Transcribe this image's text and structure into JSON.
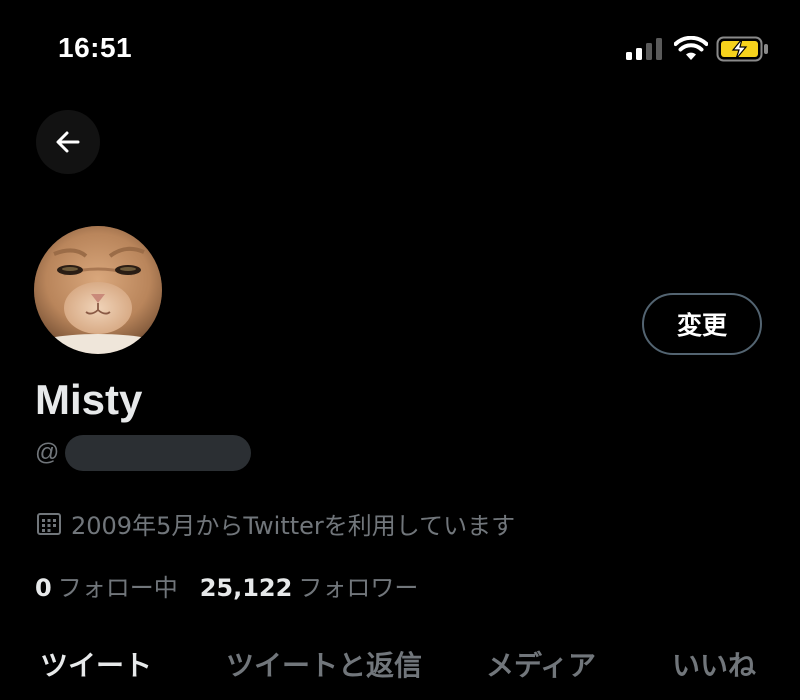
{
  "status_bar": {
    "time": "16:51",
    "icons": [
      "signal-icon",
      "wifi-icon",
      "battery-charging-icon"
    ],
    "battery_color": "#f5d21c"
  },
  "profile": {
    "display_name": "Misty",
    "handle_prefix": "@",
    "edit_label": "変更",
    "joined_text": "2009年5月からTwitterを利用しています",
    "following_count": "0",
    "following_label": "フォロー中",
    "followers_count": "25,122",
    "followers_label": "フォロワー"
  },
  "tabs": [
    {
      "label": "ツイート",
      "active": true
    },
    {
      "label": "ツイートと返信",
      "active": false
    },
    {
      "label": "メディア",
      "active": false
    },
    {
      "label": "いいね",
      "active": false
    }
  ],
  "colors": {
    "background": "#000000",
    "primary_text": "#e7e9ea",
    "secondary_text": "#71767b",
    "border": "#536471"
  }
}
